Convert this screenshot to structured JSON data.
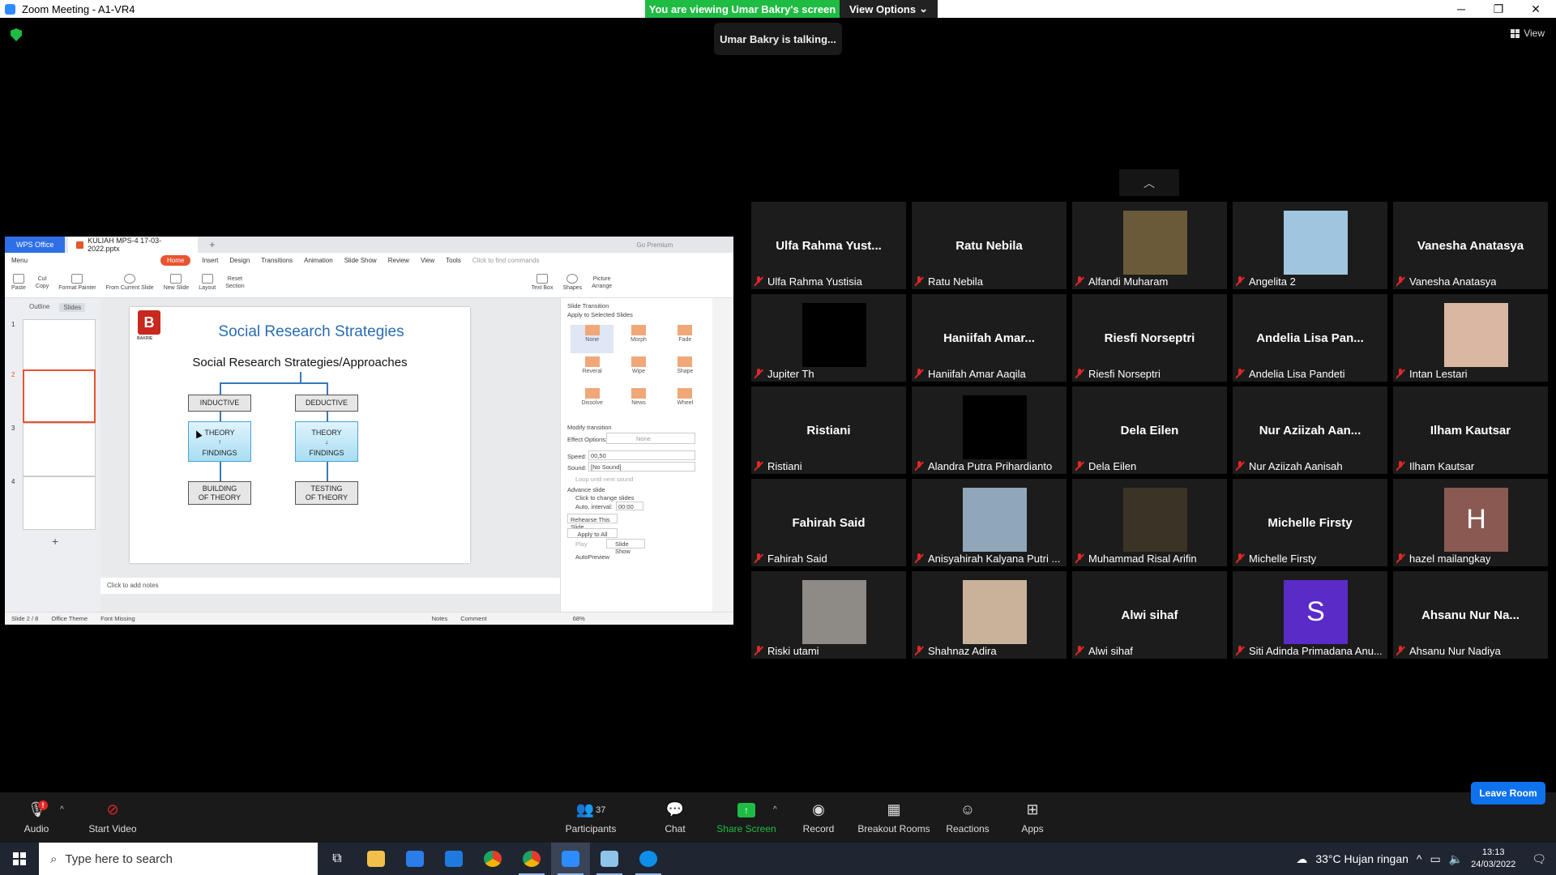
{
  "window": {
    "title": "Zoom Meeting - A1-VR4",
    "minimize": "─",
    "maximize": "❐",
    "close": "✕"
  },
  "banner": {
    "viewing": "You are viewing Umar Bakry's screen",
    "view_options": "View Options",
    "talking": "Umar Bakry is talking...",
    "view": "View"
  },
  "shared_screen": {
    "wps_tab": "WPS Office",
    "file_tab": "KULIAH MPS-4 17-03-2022.pptx",
    "premium": "Go Premium",
    "menu_items": [
      "Menu",
      "Home",
      "Insert",
      "Design",
      "Transitions",
      "Animation",
      "Slide Show",
      "Review",
      "View",
      "Tools",
      "Click to find commands"
    ],
    "ribbon": [
      "Paste",
      "Cut",
      "Copy",
      "Format Painter",
      "From Current Slide",
      "New Slide",
      "Layout",
      "Reset",
      "Section",
      "Text Box",
      "Shapes",
      "Picture",
      "Arrange"
    ],
    "outline_tab": "Outline",
    "slides_tab": "Slides",
    "thumb_numbers": [
      "1",
      "2",
      "3",
      "4"
    ],
    "slide": {
      "logo_letter": "B",
      "logo_text": "BAKRIE",
      "title": "Social Research Strategies",
      "subtitle": "Social Research Strategies/Approaches",
      "inductive": "INDUCTIVE",
      "deductive": "DEDUCTIVE",
      "theory": "THEORY",
      "findings": "FINDINGS",
      "building": "BUILDING\nOF THEORY",
      "testing": "TESTING\nOF THEORY"
    },
    "notes": "Click to add notes",
    "taskpane": {
      "header": "Slide Transition",
      "apply": "Apply to Selected Slides",
      "transitions": [
        "None",
        "Morph",
        "Fade",
        "Reveral",
        "Wipe",
        "Shape",
        "Dissolve",
        "News",
        "Wheel"
      ],
      "modify": "Modify transition",
      "effect_options": "Effect Options:",
      "effect_value": "None",
      "speed": "Speed:",
      "speed_value": "00,50",
      "sound": "Sound:",
      "sound_value": "[No Sound]",
      "loop": "Loop until next sound",
      "advance": "Advance slide",
      "click_change": "Click to change slides",
      "auto_interval": "Auto, interval:",
      "interval_value": "00:00",
      "rehearse": "Rehearse This Slide",
      "apply_all": "Apply to All",
      "play": "Play",
      "slide_show": "Slide Show",
      "autopreview": "AutoPreview"
    },
    "status": {
      "slide": "Slide 2 / 8",
      "theme": "Office Theme",
      "font": "Font Missing",
      "notes": "Notes",
      "comment": "Comment",
      "zoom": "68%"
    }
  },
  "participants": [
    {
      "big": "Ulfa Rahma Yust...",
      "name": "Ulfa Rahma Yustisia",
      "kind": "text"
    },
    {
      "big": "Ratu Nebila",
      "name": "Ratu Nebila",
      "kind": "text"
    },
    {
      "big": "",
      "name": "Alfandi Muharam",
      "kind": "photo",
      "photo": "#6b5a3a"
    },
    {
      "big": "",
      "name": "Angelita 2",
      "kind": "photo",
      "photo": "#9fc6de"
    },
    {
      "big": "Vanesha Anatasya",
      "name": "Vanesha Anatasya",
      "kind": "text"
    },
    {
      "big": "",
      "name": "Jupiter Th",
      "kind": "photo",
      "photo": "#000000"
    },
    {
      "big": "Haniifah Amar...",
      "name": "Haniifah Amar Aaqila",
      "kind": "text"
    },
    {
      "big": "Riesfi Norseptri",
      "name": "Riesfi Norseptri",
      "kind": "text"
    },
    {
      "big": "Andelia Lisa Pan...",
      "name": "Andelia Lisa Pandeti",
      "kind": "text"
    },
    {
      "big": "",
      "name": "Intan Lestari",
      "kind": "photo",
      "photo": "#d9b7a3"
    },
    {
      "big": "Ristiani",
      "name": "Ristiani",
      "kind": "text"
    },
    {
      "big": "",
      "name": "Alandra Putra Prihardianto",
      "kind": "photo",
      "photo": "#000000"
    },
    {
      "big": "Dela Eilen",
      "name": "Dela Eilen",
      "kind": "text"
    },
    {
      "big": "Nur Aziizah Aan...",
      "name": "Nur Aziizah Aanisah",
      "kind": "text"
    },
    {
      "big": "Ilham Kautsar",
      "name": "Ilham Kautsar",
      "kind": "text"
    },
    {
      "big": "Fahirah Said",
      "name": "Fahirah Said",
      "kind": "text"
    },
    {
      "big": "",
      "name": "Anisyahirah Kalyana Putri ...",
      "kind": "photo",
      "photo": "#8fa7b9"
    },
    {
      "big": "",
      "name": "Muhammad Risal Arifin",
      "kind": "photo",
      "photo": "#3b3326"
    },
    {
      "big": "Michelle Firsty",
      "name": "Michelle Firsty",
      "kind": "text"
    },
    {
      "big": "H",
      "name": "hazel mailangkay",
      "kind": "letter",
      "photo": "#8a5a52"
    },
    {
      "big": "",
      "name": "Riski utami",
      "kind": "photo",
      "photo": "#8e8a86"
    },
    {
      "big": "",
      "name": "Shahnaz Adira",
      "kind": "photo",
      "photo": "#c9b29a"
    },
    {
      "big": "Alwi sihaf",
      "name": "Alwi sihaf",
      "kind": "text"
    },
    {
      "big": "S",
      "name": "Siti Adinda Primadana Anu...",
      "kind": "letter",
      "photo": "#5b2bc8"
    },
    {
      "big": "Ahsanu Nur Na...",
      "name": "Ahsanu Nur Nadiya",
      "kind": "text"
    }
  ],
  "toolbar": {
    "audio": "Audio",
    "audio_badge": "!",
    "start_video": "Start Video",
    "participants": "Participants",
    "participants_count": "37",
    "chat": "Chat",
    "share_screen": "Share Screen",
    "record": "Record",
    "breakout": "Breakout Rooms",
    "reactions": "Reactions",
    "apps": "Apps",
    "leave": "Leave Room"
  },
  "taskbar": {
    "search_placeholder": "Type here to search",
    "weather": "33°C  Hujan ringan",
    "time": "13:13",
    "date": "24/03/2022"
  },
  "colors": {
    "green": "#1fbc43",
    "zoom_blue": "#0e72ed",
    "wps_orange": "#e8542f",
    "mute_red": "#e02828"
  }
}
